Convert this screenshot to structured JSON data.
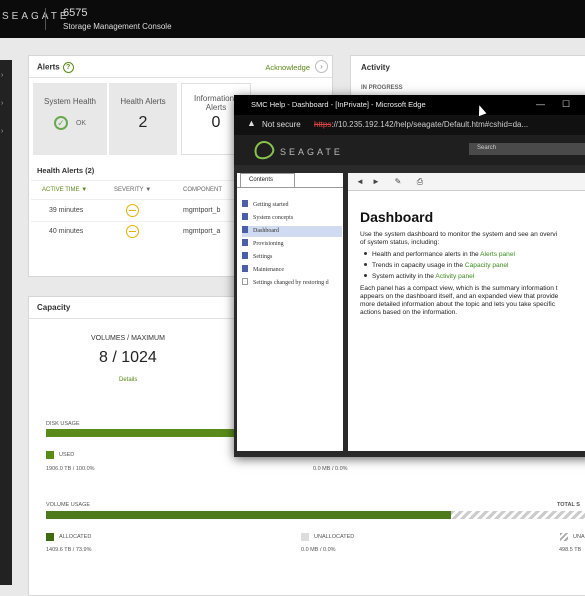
{
  "header": {
    "brand": "SEAGATE",
    "system_name": "6575",
    "app_title": "Storage Management Console"
  },
  "alerts": {
    "title": "Alerts",
    "acknowledge": "Acknowledge",
    "tiles": {
      "system_health": "System Health",
      "status": "OK",
      "health_alerts": "Health Alerts",
      "health_count": "2",
      "info_alerts": "Informational Alerts",
      "info_count": "0"
    },
    "health_alerts_title": "Health Alerts (2)",
    "columns": [
      "ACTIVE TIME",
      "SEVERITY",
      "COMPONENT"
    ],
    "rows": [
      {
        "time": "39 minutes",
        "component": "mgmtport_b"
      },
      {
        "time": "40 minutes",
        "component": "mgmtport_a"
      }
    ]
  },
  "activity": {
    "title": "Activity",
    "in_progress": "IN PROGRESS"
  },
  "capacity": {
    "title": "Capacity",
    "volumes_label": "VOLUMES / MAXIMUM",
    "volumes_value": "8 / 1024",
    "details": "Details",
    "disk_usage": "DISK USAGE",
    "used": "USED",
    "used_value": "1906.0 TB / 100.0%",
    "disk_other_value": "0.0 MB / 0.0%",
    "disk_used_fraction": 1.0,
    "volume_usage": "VOLUME USAGE",
    "total": "TOTAL S",
    "allocated": "ALLOCATED",
    "allocated_value": "1409.6 TB / 73.9%",
    "allocated_fraction": 0.739,
    "unallocated": "UNALLOCATED",
    "unallocated_value": "0.0 MB / 0.0%",
    "una": "UNA",
    "right_value": "498.5 TB",
    "colors": {
      "used": "#5a8a1a",
      "accent": "#5a8a1a"
    }
  },
  "browser": {
    "title": "SMC Help - Dashboard - [InPrivate] - Microsoft Edge",
    "not_secure": "Not secure",
    "url_scheme": "https",
    "url_rest": "://10.235.192.142/help/seagate/Default.htm#cshid=da...",
    "brand": "SEAGATE",
    "search_placeholder": "Search",
    "contents_tab": "Contents",
    "toc": [
      "Getting started",
      "System concepts",
      "Dashboard",
      "Provisioning",
      "Settings",
      "Maintenance",
      "Settings changed by restoring d"
    ],
    "heading": "Dashboard",
    "intro_1": "Use the system dashboard to monitor the system and see an overvi",
    "intro_2": "of system status, including:",
    "bullets": [
      {
        "pre": "Health and performance alerts in the ",
        "link": "Alerts panel"
      },
      {
        "pre": "Trends in capacity usage in the ",
        "link": "Capacity panel"
      },
      {
        "pre": "System activity in the ",
        "link": "Activity panel"
      }
    ],
    "para_lines": [
      "Each panel has a compact view, which is the summary information t",
      "appears on the dashboard itself, and an expanded view that provide",
      "more detailed information about the topic and lets you take specific",
      "actions based on the information."
    ]
  }
}
